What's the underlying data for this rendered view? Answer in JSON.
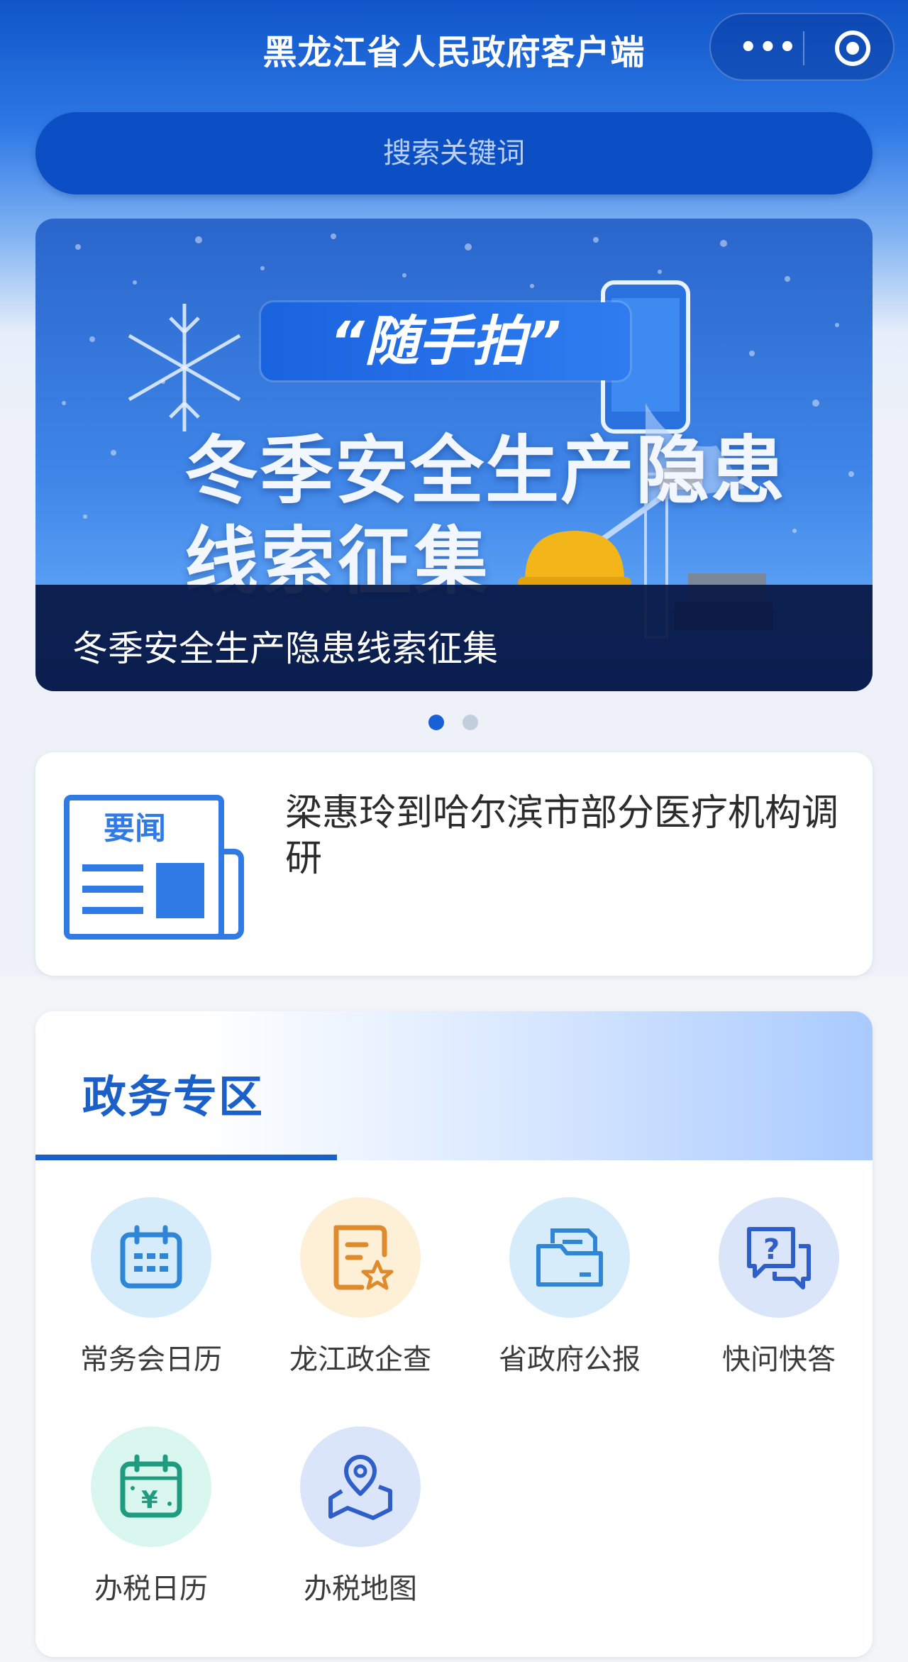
{
  "header": {
    "title": "黑龙江省人民政府客户端",
    "more_label": "•••"
  },
  "search": {
    "placeholder": "搜索关键词"
  },
  "banner": {
    "tag": "“随手拍”",
    "headline_line1": "冬季安全生产隐患",
    "headline_line2": "线索征集",
    "caption": "冬季安全生产隐患线索征集",
    "slide_count": 2,
    "active_slide": 1
  },
  "news": {
    "icon_text": "要闻",
    "headline": "梁惠玲到哈尔滨市部分医疗机构调研"
  },
  "services": {
    "title": "政务专区",
    "items": [
      {
        "label": "常务会日历",
        "icon": "calendar-icon",
        "color": "#2f86d6",
        "bg": "#d7ecfb"
      },
      {
        "label": "龙江政企查",
        "icon": "certificate-star-icon",
        "color": "#e08a2e",
        "bg": "#fdf0d6"
      },
      {
        "label": "省政府公报",
        "icon": "folder-document-icon",
        "color": "#2f86d6",
        "bg": "#d7ecfb"
      },
      {
        "label": "快问快答",
        "icon": "question-chat-icon",
        "color": "#2e5fc8",
        "bg": "#dbe5fa"
      },
      {
        "label": "办税日历",
        "icon": "tax-calendar-icon",
        "color": "#1f9c80",
        "bg": "#d9f7ef"
      },
      {
        "label": "办税地图",
        "icon": "map-pin-icon",
        "color": "#2e5fc8",
        "bg": "#dbe5fa"
      }
    ]
  }
}
